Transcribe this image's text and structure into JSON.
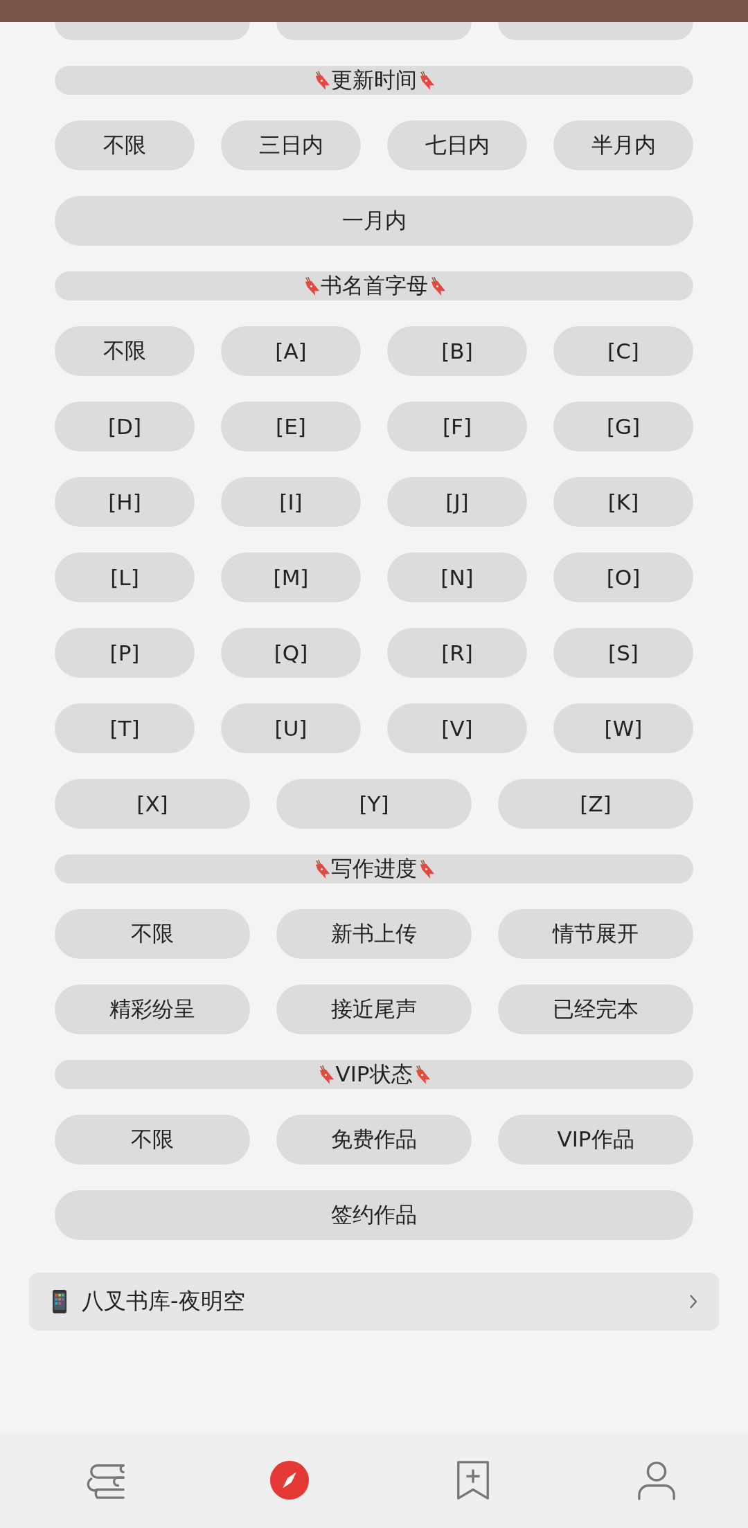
{
  "groups": [
    {
      "title": "更新时间",
      "rows": [
        [
          "不限",
          "三日内",
          "七日内",
          "半月内"
        ]
      ],
      "wide_option": "一月内"
    },
    {
      "title": "书名首字母",
      "rows": [
        [
          "不限",
          "[A]",
          "[B]",
          "[C]"
        ],
        [
          "[D]",
          "[E]",
          "[F]",
          "[G]"
        ],
        [
          "[H]",
          "[I]",
          "[J]",
          "[K]"
        ],
        [
          "[L]",
          "[M]",
          "[N]",
          "[O]"
        ],
        [
          "[P]",
          "[Q]",
          "[R]",
          "[S]"
        ],
        [
          "[T]",
          "[U]",
          "[V]",
          "[W]"
        ],
        [
          "[X]",
          "[Y]",
          "[Z]"
        ]
      ]
    },
    {
      "title": "写作进度",
      "rows": [
        [
          "不限",
          "新书上传",
          "情节展开"
        ],
        [
          "精彩纷呈",
          "接近尾声",
          "已经完本"
        ]
      ]
    },
    {
      "title": "VIP状态",
      "rows": [
        [
          "不限",
          "免费作品",
          "VIP作品"
        ]
      ],
      "wide_option": "签约作品"
    }
  ],
  "source_link": {
    "label": "八叉书库-夜明空"
  },
  "nav": [
    {
      "kind": "books",
      "selected": false
    },
    {
      "kind": "discover",
      "selected": true
    },
    {
      "kind": "bookmark",
      "selected": false
    },
    {
      "kind": "profile",
      "selected": false
    }
  ]
}
